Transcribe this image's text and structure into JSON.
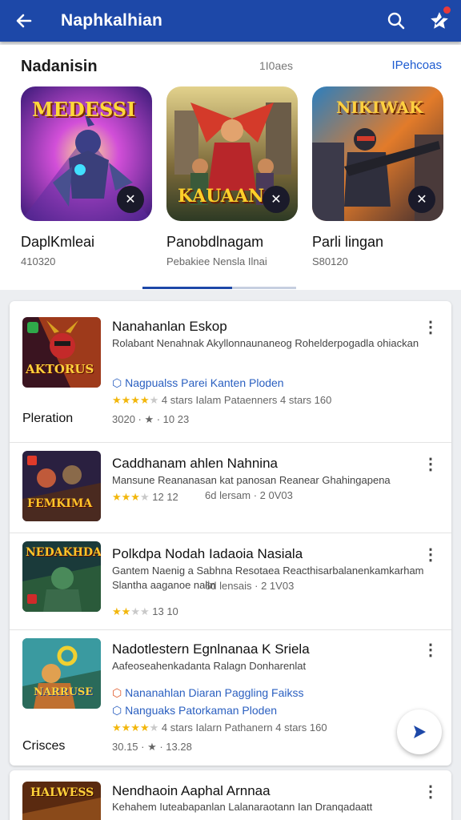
{
  "appbar": {
    "title": "Naphkalhian",
    "back_icon": "arrow-left-icon",
    "search_icon": "search-icon",
    "notify_icon": "notification-icon",
    "accent": "#1d48a8"
  },
  "featured": {
    "title": "Nadanisin",
    "count": "1I0aes",
    "link": "IPehcoas",
    "items": [
      {
        "name": "DaplKmleai",
        "sub": "410320",
        "art_title": "MEDESSI"
      },
      {
        "name": "Panobdlnagam",
        "sub": "Pebakiee Nensla Ilnai",
        "art_title": "KAUAANA"
      },
      {
        "name": "Parli lingan",
        "sub": "S80120",
        "art_title": "NIKIWAK"
      }
    ]
  },
  "list": {
    "items": [
      {
        "title": "Nanahanlan Eskop",
        "desc": "Rolabant Nenahnak Akyllonnaunaneog Rohelderpogadla ohiackan",
        "tags": "Nagpualss  Parei Kanten Ploden",
        "rating_line": "4 stars  Ialam  Pataenners  4 stars  160",
        "platform": "Pleration",
        "meta": "3020 · ★ · 10 23",
        "thumb_title": "AKTORUS",
        "rating": 3.5
      },
      {
        "title": "Caddhanam ahlen Nahnina",
        "desc": "Mansune Reananasan kat panosan Reanear Ghahingapena",
        "meta": "12 12",
        "meta2": "6d lersam · 2 0V03",
        "thumb_title": "FEMKIMA",
        "rating": 2.5
      },
      {
        "title": "Polkdpa Nodah Iadaoia Nasiala",
        "desc": "Gantem Naenig a Sabhna Resotaea Reacthisarbalanenkamkarham Slantha aaganoe nalin",
        "meta": "13 10",
        "meta2": "6d lensais · 2 1V03",
        "thumb_title": "NEDAKHDA",
        "rating": 1.5
      },
      {
        "title": "Nadotlestern Egnlnanaa K Sriela",
        "desc": "Aafeoseahenkadanta Ralagn Donharenlat",
        "tags2": "Nananahlan Diaran Paggling Faikss",
        "tags": "Nanguaks  Patorkaman Ploden",
        "rating_line": "4 stars  Ialarn  Pathanern  4 stars  160",
        "platform": "Crisces",
        "meta": "30.15 · ★ · 13.28",
        "thumb_title": "NARRUSE",
        "rating": 4
      }
    ]
  },
  "card2": {
    "title": "Nendhaoin Aaphal Arnnaa",
    "desc": "Kehahem Iuteabapanlan Lalanaraotann Ian Dranqadaatt",
    "thumb_title": "HALWESS"
  },
  "fab": {
    "icon": "send-icon"
  }
}
